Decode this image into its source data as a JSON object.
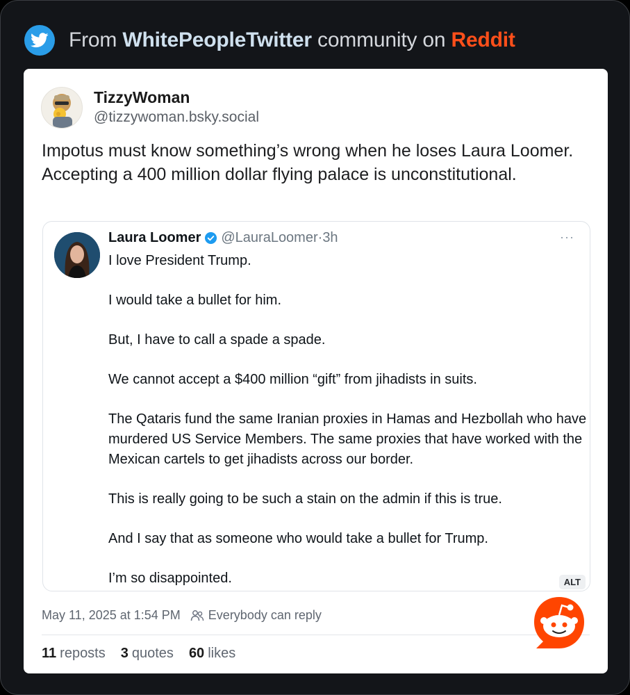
{
  "header": {
    "prefix": "From",
    "community": "WhitePeopleTwitter",
    "middle": "community on",
    "platform": "Reddit",
    "icon": "twitter-bird-icon",
    "colors": {
      "platform": "#ff4f1a",
      "badge": "#2a9de8"
    }
  },
  "post": {
    "author_name": "TizzyWoman",
    "author_handle": "@tizzywoman.bsky.social",
    "text_line1": "Impotus must know something’s wrong when he loses Laura Loomer.",
    "text_line2": "Accepting a 400 million dollar flying palace is unconstitutional.",
    "timestamp": "May 11, 2025 at 1:54 PM",
    "reply_setting": "Everybody can reply",
    "reposts_count": "11",
    "reposts_label": "reposts",
    "quotes_count": "3",
    "quotes_label": "quotes",
    "likes_count": "60",
    "likes_label": "likes"
  },
  "quoted": {
    "name": "Laura Loomer",
    "handle": "@LauraLoomer",
    "separator": "·",
    "time": "3h",
    "more": "···",
    "verified_icon": "verified-badge-icon",
    "paragraphs": [
      "I love President Trump.",
      "I would take a bullet for him.",
      "But, I have to call a spade a spade.",
      "We cannot accept a $400 million “gift” from jihadists in suits.",
      "The Qataris fund the same Iranian proxies in Hamas and Hezbollah who have murdered US Service Members. The same proxies that have worked with the Mexican cartels to get jihadists across our border.",
      "This is really going to be such a stain on the admin if this is true.",
      "And I say that as someone who would take a bullet for Trump.",
      "I’m so disappointed."
    ],
    "alt_label": "ALT"
  },
  "watermark": {
    "icon": "reddit-snoo-icon"
  }
}
